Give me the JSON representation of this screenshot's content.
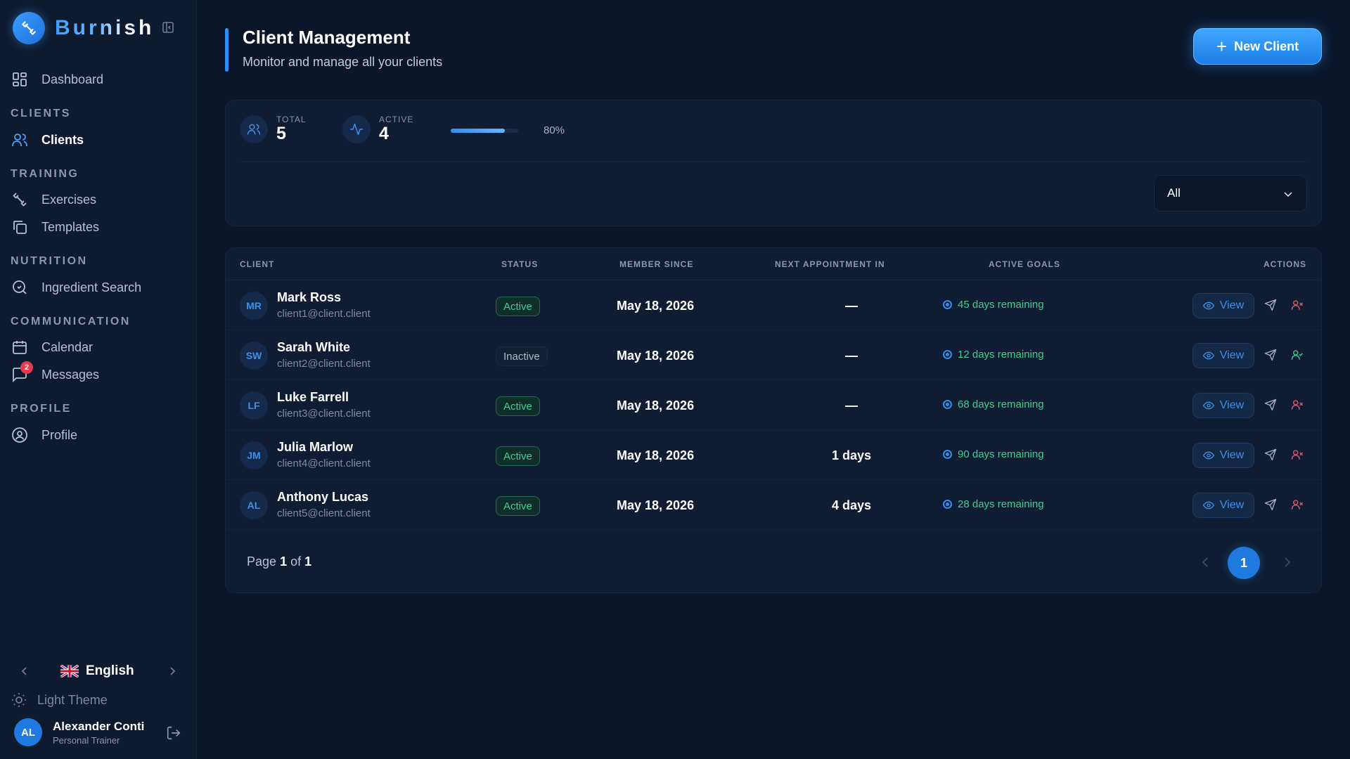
{
  "app": {
    "name": "Burnish"
  },
  "sidebar": {
    "items": {
      "dashboard": "Dashboard",
      "clients": "Clients",
      "exercises": "Exercises",
      "templates": "Templates",
      "ingredient_search": "Ingredient Search",
      "calendar": "Calendar",
      "messages": "Messages",
      "profile": "Profile"
    },
    "sections": {
      "clients": "CLIENTS",
      "training": "TRAINING",
      "nutrition": "NUTRITION",
      "communication": "COMMUNICATION",
      "profile": "PROFILE"
    },
    "messages_badge": "2",
    "language": "English",
    "theme_toggle": "Light Theme",
    "user": {
      "initials": "AL",
      "name": "Alexander Conti",
      "role": "Personal Trainer"
    }
  },
  "header": {
    "title": "Client Management",
    "subtitle": "Monitor and manage all your clients",
    "new_button": "New Client"
  },
  "stats": {
    "total_label": "TOTAL",
    "total_value": "5",
    "active_label": "ACTIVE",
    "active_value": "4",
    "active_percent_label": "80%",
    "active_fraction": 0.8
  },
  "filter": {
    "selected": "All"
  },
  "table": {
    "columns": {
      "client": "CLIENT",
      "status": "STATUS",
      "member_since": "MEMBER SINCE",
      "next_appointment": "NEXT APPOINTMENT IN",
      "active_goals": "ACTIVE GOALS",
      "actions": "ACTIONS"
    },
    "view_label": "View",
    "rows": [
      {
        "initials": "MR",
        "name": "Mark Ross",
        "email": "client1@client.client",
        "status": "Active",
        "member_since": "May 18, 2026",
        "next_appointment": "—",
        "goals": "45 days remaining"
      },
      {
        "initials": "SW",
        "name": "Sarah White",
        "email": "client2@client.client",
        "status": "Inactive",
        "member_since": "May 18, 2026",
        "next_appointment": "—",
        "goals": "12 days remaining"
      },
      {
        "initials": "LF",
        "name": "Luke Farrell",
        "email": "client3@client.client",
        "status": "Active",
        "member_since": "May 18, 2026",
        "next_appointment": "—",
        "goals": "68 days remaining"
      },
      {
        "initials": "JM",
        "name": "Julia Marlow",
        "email": "client4@client.client",
        "status": "Active",
        "member_since": "May 18, 2026",
        "next_appointment": "1 days",
        "goals": "90 days remaining"
      },
      {
        "initials": "AL",
        "name": "Anthony Lucas",
        "email": "client5@client.client",
        "status": "Active",
        "member_since": "May 18, 2026",
        "next_appointment": "4 days",
        "goals": "28 days remaining"
      }
    ]
  },
  "pagination": {
    "prefix": "Page",
    "current": "1",
    "separator": "of",
    "total": "1",
    "page_button": "1"
  },
  "colors": {
    "accent": "#2f8ff0",
    "active_green": "#3fd08f",
    "deactivate_red": "#e5566a",
    "activate_green": "#3fd08f",
    "background": "#0b1629"
  }
}
